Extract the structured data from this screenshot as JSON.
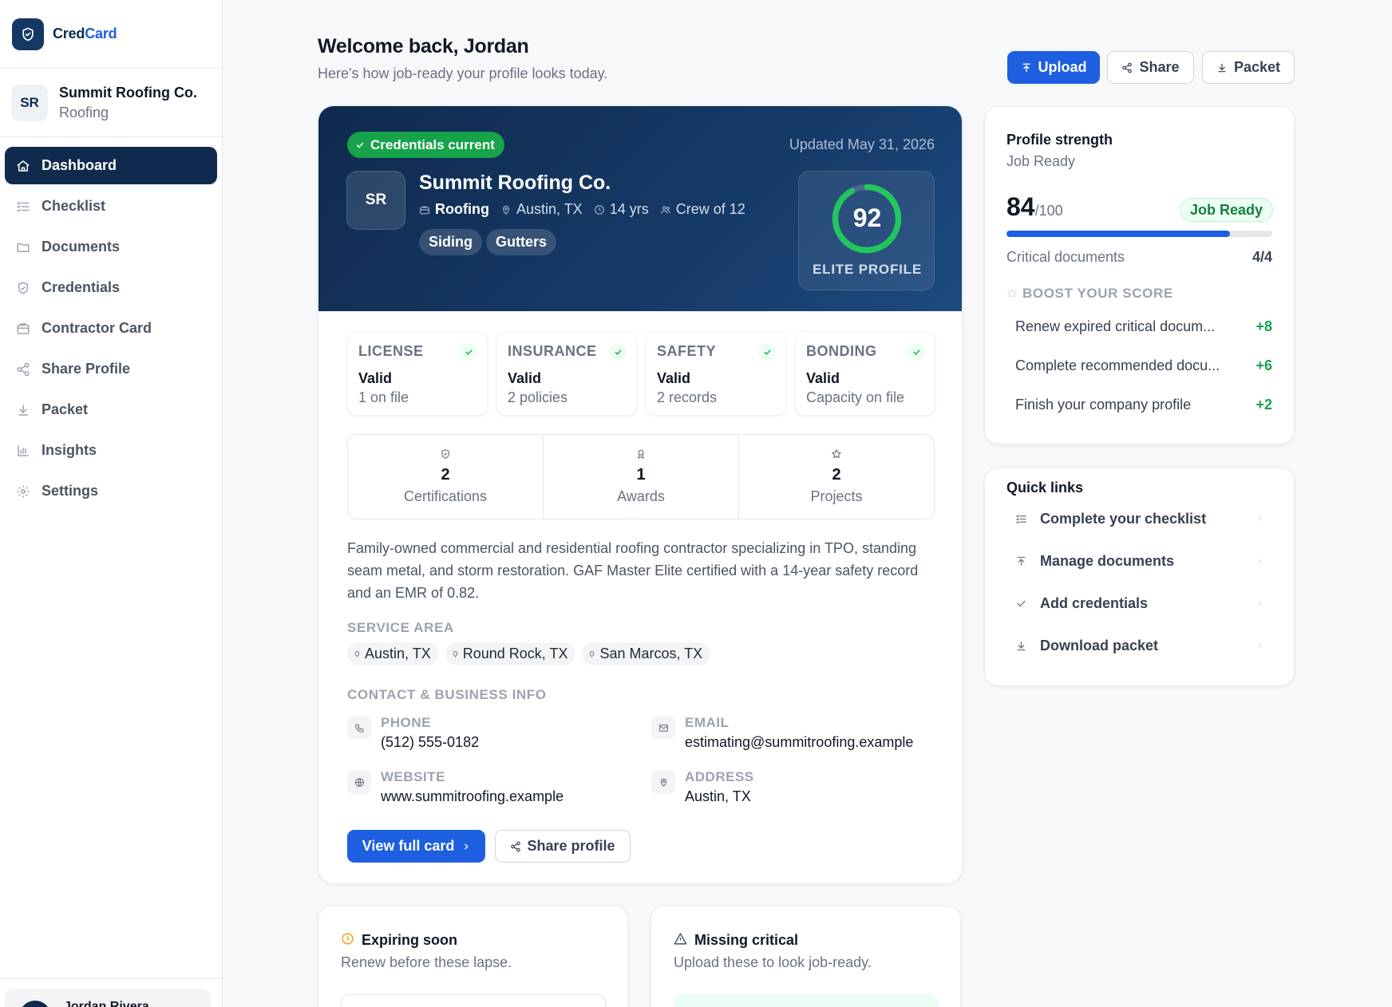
{
  "brand": {
    "name_a": "Cred",
    "name_b": "Card"
  },
  "company": {
    "initials": "SR",
    "name": "Summit Roofing Co.",
    "trade": "Roofing"
  },
  "nav": [
    {
      "label": "Dashboard",
      "icon": "home-icon",
      "active": true
    },
    {
      "label": "Checklist",
      "icon": "checklist-icon"
    },
    {
      "label": "Documents",
      "icon": "folder-icon"
    },
    {
      "label": "Credentials",
      "icon": "shield-icon"
    },
    {
      "label": "Contractor Card",
      "icon": "card-icon"
    },
    {
      "label": "Share Profile",
      "icon": "share-icon"
    },
    {
      "label": "Packet",
      "icon": "download-icon"
    },
    {
      "label": "Insights",
      "icon": "bar-chart-icon"
    },
    {
      "label": "Settings",
      "icon": "gear-icon"
    }
  ],
  "user": {
    "name": "Jordan Rivera"
  },
  "header": {
    "title": "Welcome back, Jordan",
    "subtitle": "Here's how job-ready your profile looks today.",
    "upload_label": "Upload",
    "share_label": "Share",
    "packet_label": "Packet"
  },
  "hero": {
    "badge": "Credentials current",
    "updated": "Updated May 31, 2026",
    "initials": "SR",
    "name": "Summit Roofing Co.",
    "trade": "Roofing",
    "location": "Austin, TX",
    "years": "14 yrs",
    "crew": "Crew of 12",
    "tags": [
      "Siding",
      "Gutters"
    ],
    "score": "92",
    "score_value": 92,
    "score_label": "ELITE PROFILE"
  },
  "status": [
    {
      "title": "LICENSE",
      "value": "Valid",
      "detail": "1 on file"
    },
    {
      "title": "INSURANCE",
      "value": "Valid",
      "detail": "2 policies"
    },
    {
      "title": "SAFETY",
      "value": "Valid",
      "detail": "2 records"
    },
    {
      "title": "BONDING",
      "value": "Valid",
      "detail": "Capacity on file"
    }
  ],
  "stats": [
    {
      "num": "2",
      "label": "Certifications",
      "icon": "shield-check-icon"
    },
    {
      "num": "1",
      "label": "Awards",
      "icon": "award-icon"
    },
    {
      "num": "2",
      "label": "Projects",
      "icon": "star-icon"
    }
  ],
  "description": "Family-owned commercial and residential roofing contractor specializing in TPO, standing seam metal, and storm restoration. GAF Master Elite certified with a 14-year safety record and an EMR of 0.82.",
  "service_area": {
    "heading": "SERVICE AREA",
    "items": [
      "Austin, TX",
      "Round Rock, TX",
      "San Marcos, TX"
    ]
  },
  "contact": {
    "heading": "CONTACT & BUSINESS INFO",
    "phone_label": "PHONE",
    "phone": "(512) 555-0182",
    "email_label": "EMAIL",
    "email": "estimating@summitroofing.example",
    "website_label": "WEBSITE",
    "website": "www.summitroofing.example",
    "address_label": "ADDRESS",
    "address": "Austin, TX"
  },
  "card_actions": {
    "view_label": "View full card",
    "share_label": "Share profile"
  },
  "strength": {
    "title": "Profile strength",
    "status": "Job Ready",
    "score": "84",
    "out_of": "/100",
    "badge": "Job Ready",
    "progress": 0.84,
    "critical_label": "Critical documents",
    "critical_value": "4/4",
    "boost_heading": "BOOST YOUR SCORE",
    "boosts": [
      {
        "label": "Renew expired critical docum...",
        "points": "+8"
      },
      {
        "label": "Complete recommended docu...",
        "points": "+6"
      },
      {
        "label": "Finish your company profile",
        "points": "+2"
      }
    ]
  },
  "quick_links": {
    "title": "Quick links",
    "items": [
      {
        "label": "Complete your checklist",
        "icon": "checklist-icon"
      },
      {
        "label": "Manage documents",
        "icon": "upload-icon"
      },
      {
        "label": "Add credentials",
        "icon": "check-icon"
      },
      {
        "label": "Download packet",
        "icon": "download-icon"
      }
    ]
  },
  "expiring": {
    "title": "Expiring soon",
    "subtitle": "Renew before these lapse."
  },
  "missing": {
    "title": "Missing critical",
    "subtitle": "Upload these to look job-ready."
  },
  "colors": {
    "navy": "#0f2a4d",
    "primary": "#1d5fe0",
    "success": "#16a34a",
    "warning": "#f59e0b"
  }
}
